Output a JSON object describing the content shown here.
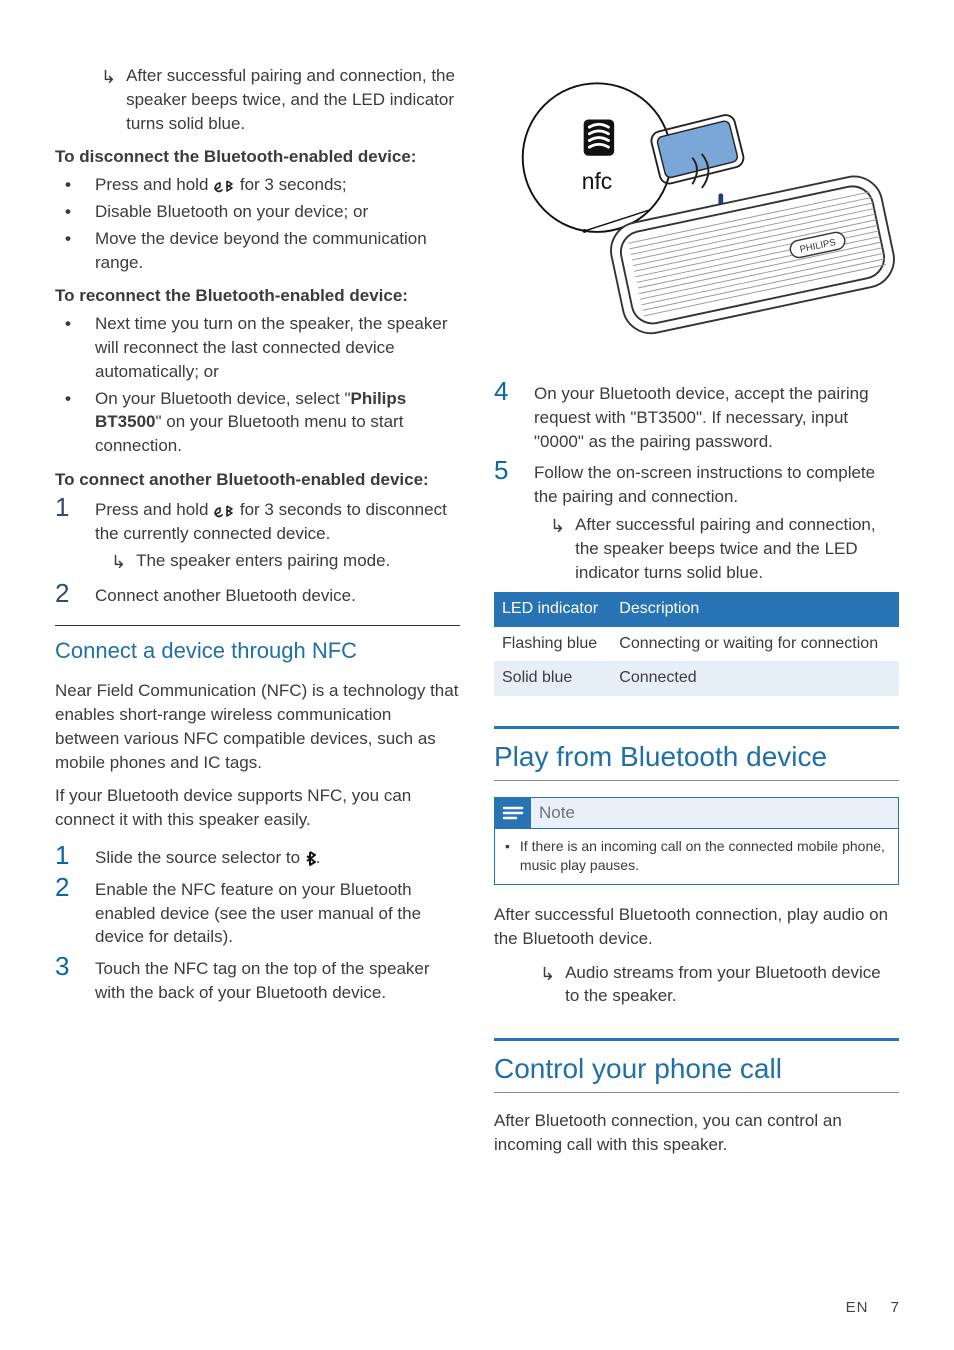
{
  "left": {
    "result1": "After successful pairing and connection, the speaker beeps twice, and the LED indicator turns solid blue.",
    "disconnect_heading": "To disconnect the Bluetooth-enabled device:",
    "disconnect": {
      "b1a": "Press and hold ",
      "b1b": " for 3 seconds;",
      "b2": "Disable Bluetooth on your device; or",
      "b3": "Move the device beyond the communication range."
    },
    "reconnect_heading": "To reconnect the Bluetooth-enabled device:",
    "reconnect": {
      "b1": "Next time you turn on the speaker, the speaker will reconnect the last connected device automatically; or",
      "b2a": "On your Bluetooth device, select \"",
      "b2bold": "Philips BT3500",
      "b2b": "\" on your Bluetooth menu to start connection."
    },
    "another_heading": "To connect another Bluetooth-enabled device:",
    "another": {
      "s1a": "Press and hold ",
      "s1b": " for 3 seconds to disconnect the currently connected device.",
      "s1r": "The speaker enters pairing mode.",
      "s2": "Connect another Bluetooth device."
    },
    "nfc_heading": "Connect a device through NFC",
    "nfc_p1": "Near Field Communication (NFC) is a technology that enables short-range wireless communication between various NFC compatible devices, such as mobile phones and IC tags.",
    "nfc_p2": "If your Bluetooth device supports NFC, you can connect it with this speaker easily.",
    "nfc_steps": {
      "s1a": "Slide the source selector to ",
      "s1b": ".",
      "s2": "Enable the NFC feature on your Bluetooth enabled device (see the user manual of the device for details).",
      "s3": "Touch the NFC tag on the top of the speaker with the back of your Bluetooth device."
    }
  },
  "right": {
    "steps": {
      "s4": "On your Bluetooth device, accept the pairing request with \"BT3500\". If necessary, input \"0000\" as the pairing password.",
      "s5": "Follow the on-screen instructions to complete the pairing and connection.",
      "s5r": "After successful pairing and connection, the speaker beeps twice and the LED indicator turns solid blue."
    },
    "table": {
      "h1": "LED indicator",
      "h2": "Description",
      "r1c1": "Flashing blue",
      "r1c2": "Connecting or waiting for connection",
      "r2c1": "Solid blue",
      "r2c2": "Connected"
    },
    "play_heading": "Play from Bluetooth device",
    "note_label": "Note",
    "note_bullet": "If there is an incoming call on the connected mobile phone, music play pauses.",
    "play_p1": "After successful Bluetooth connection, play audio on the Bluetooth device.",
    "play_r": "Audio streams from your Bluetooth device to the speaker.",
    "call_heading": "Control your phone call",
    "call_p1": "After Bluetooth connection, you can control an incoming call with this speaker."
  },
  "pagefoot": {
    "lang": "EN",
    "num": "7"
  },
  "numerals": {
    "n1": "1",
    "n2": "2",
    "n3": "3",
    "n4": "4",
    "n5": "5"
  },
  "illus": {
    "nfc_label": "nfc",
    "brand": "PHILIPS"
  }
}
